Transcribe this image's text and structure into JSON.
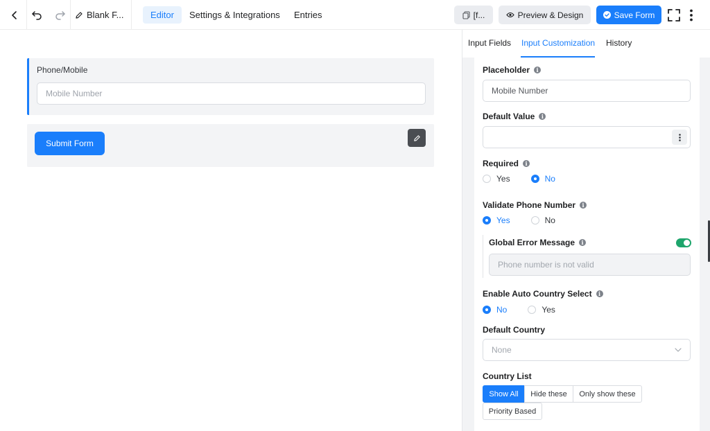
{
  "topbar": {
    "form_title": "Blank F...",
    "tabs": [
      {
        "label": "Editor",
        "active": true
      },
      {
        "label": "Settings & Integrations",
        "active": false
      },
      {
        "label": "Entries",
        "active": false
      }
    ],
    "shortcode_label": "[f...",
    "preview_label": "Preview & Design",
    "save_label": "Save Form"
  },
  "canvas": {
    "field_label": "Phone/Mobile",
    "field_placeholder": "Mobile Number",
    "submit_label": "Submit Form"
  },
  "panel": {
    "tabs": [
      {
        "label": "Input Fields",
        "active": false
      },
      {
        "label": "Input Customization",
        "active": true
      },
      {
        "label": "History",
        "active": false
      }
    ],
    "placeholder": {
      "label": "Placeholder",
      "value": "Mobile Number"
    },
    "default_value": {
      "label": "Default Value",
      "value": ""
    },
    "required": {
      "label": "Required",
      "options": [
        "Yes",
        "No"
      ],
      "selected": "No"
    },
    "validate_phone": {
      "label": "Validate Phone Number",
      "options": [
        "Yes",
        "No"
      ],
      "selected": "Yes"
    },
    "global_error": {
      "label": "Global Error Message",
      "enabled": true,
      "value": "Phone number is not valid"
    },
    "auto_country": {
      "label": "Enable Auto Country Select",
      "options": [
        "No",
        "Yes"
      ],
      "selected": "No"
    },
    "default_country": {
      "label": "Default Country",
      "value": "None"
    },
    "country_list": {
      "label": "Country List",
      "options": [
        "Show All",
        "Hide these",
        "Only show these",
        "Priority Based"
      ],
      "selected": "Show All"
    }
  },
  "colors": {
    "accent": "#1a7efb",
    "toggle_on": "#1ea56c",
    "panel_bg": "#f2f3f5"
  }
}
